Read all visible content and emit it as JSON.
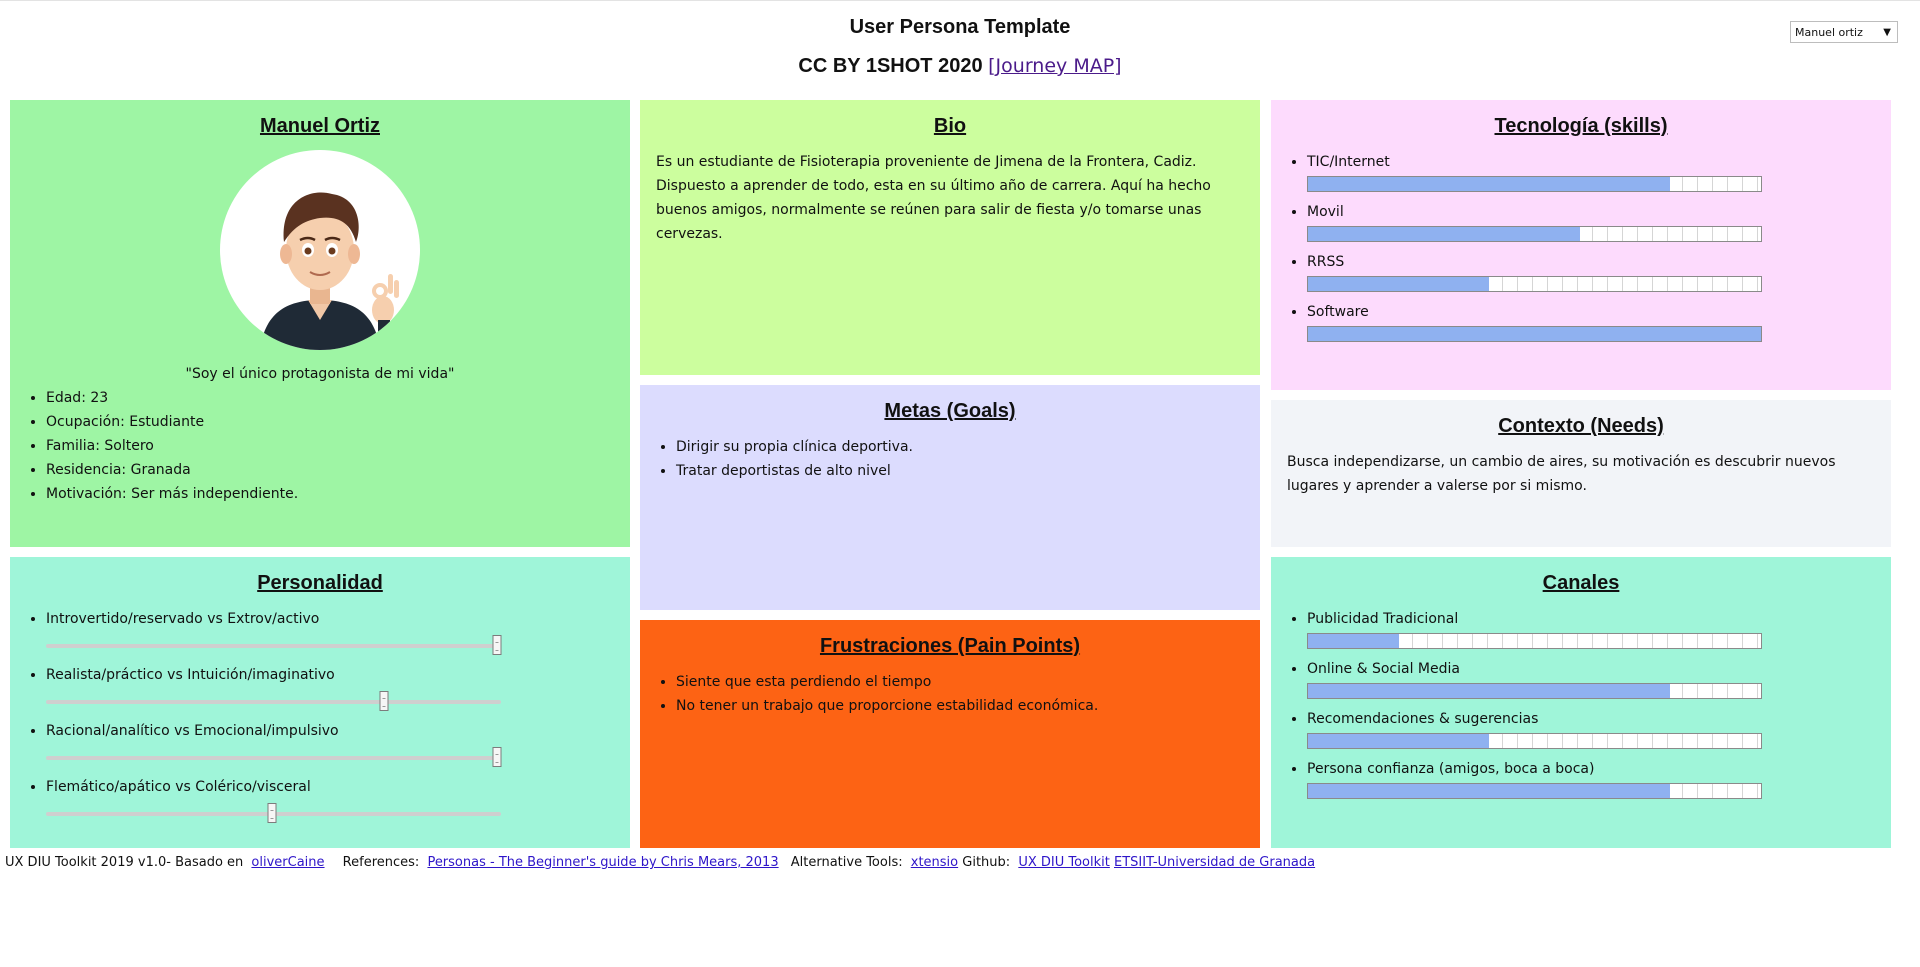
{
  "header": {
    "title": "User Persona Template",
    "subtitle": "CC BY 1SHOT 2020",
    "journey_link": "[Journey MAP]"
  },
  "persona_select": {
    "value": "Manuel ortiz"
  },
  "profile": {
    "name": "Manuel Ortiz",
    "quote": "\"Soy el único protagonista de mi vida\"",
    "facts": [
      "Edad: 23",
      "Ocupación: Estudiante",
      "Familia: Soltero",
      "Residencia: Granada",
      "Motivación: Ser más independiente."
    ]
  },
  "personality": {
    "title": "Personalidad",
    "traits": [
      {
        "label": "Introvertido/reservado vs Extrov/activo",
        "value": 1.0
      },
      {
        "label": "Realista/práctico vs Intuición/imaginativo",
        "value": 0.75
      },
      {
        "label": "Racional/analítico vs Emocional/impulsivo",
        "value": 1.0
      },
      {
        "label": "Flemático/apático vs Colérico/visceral",
        "value": 0.5
      }
    ]
  },
  "bio": {
    "title": "Bio",
    "text": "Es un estudiante de Fisioterapia proveniente de Jimena de la Frontera, Cadiz. Dispuesto a aprender de todo, esta en su último año de carrera. Aquí ha hecho buenos amigos, normalmente se reúnen para salir de fiesta y/o tomarse unas cervezas."
  },
  "goals": {
    "title": "Metas (Goals)",
    "items": [
      "Dirigir su propia clínica deportiva.",
      "Tratar deportistas de alto nivel"
    ]
  },
  "pain": {
    "title": "Frustraciones (Pain Points)",
    "items": [
      "Siente que esta perdiendo el tiempo",
      "No tener un trabajo que proporcione estabilidad económica."
    ]
  },
  "tech": {
    "title": "Tecnología (skills)",
    "skills": [
      {
        "label": "TIC/Internet",
        "value": 0.8
      },
      {
        "label": "Movil",
        "value": 0.6
      },
      {
        "label": "RRSS",
        "value": 0.4
      },
      {
        "label": "Software",
        "value": 1.0
      }
    ]
  },
  "context": {
    "title": "Contexto (Needs)",
    "text": "Busca independizarse, un cambio de aires, su motivación es descubrir nuevos lugares y aprender a valerse por si mismo."
  },
  "channels": {
    "title": "Canales",
    "items": [
      {
        "label": "Publicidad Tradicional",
        "value": 0.2
      },
      {
        "label": "Online & Social Media",
        "value": 0.8
      },
      {
        "label": "Recomendaciones & sugerencias",
        "value": 0.4
      },
      {
        "label": "Persona confianza (amigos, boca a boca)",
        "value": 0.8
      }
    ]
  },
  "footer": {
    "toolkit_text": "UX DIU Toolkit 2019 v1.0- Basado en",
    "olivercaine": "oliverCaine",
    "references_text": "References:",
    "personas_link": "Personas - The Beginner's guide by Chris Mears, 2013",
    "alt_tools_text": "Alternative Tools:",
    "xtensio": "xtensio",
    "github_text": "Github:",
    "toolkit_link": "UX DIU Toolkit",
    "ugr_link": "ETSIIT-Universidad de Granada"
  },
  "colors": {
    "profile_bg": "#9ef5a4",
    "personality_bg": "#9ff5d9",
    "bio_bg": "#ccfe9e",
    "goals_bg": "#dcdcfe",
    "pain_bg": "#fd6314",
    "tech_bg": "#fddbfd",
    "context_bg": "#f2f4f8",
    "bar_fill": "#8fb1f0",
    "link": "#2e15c9"
  }
}
